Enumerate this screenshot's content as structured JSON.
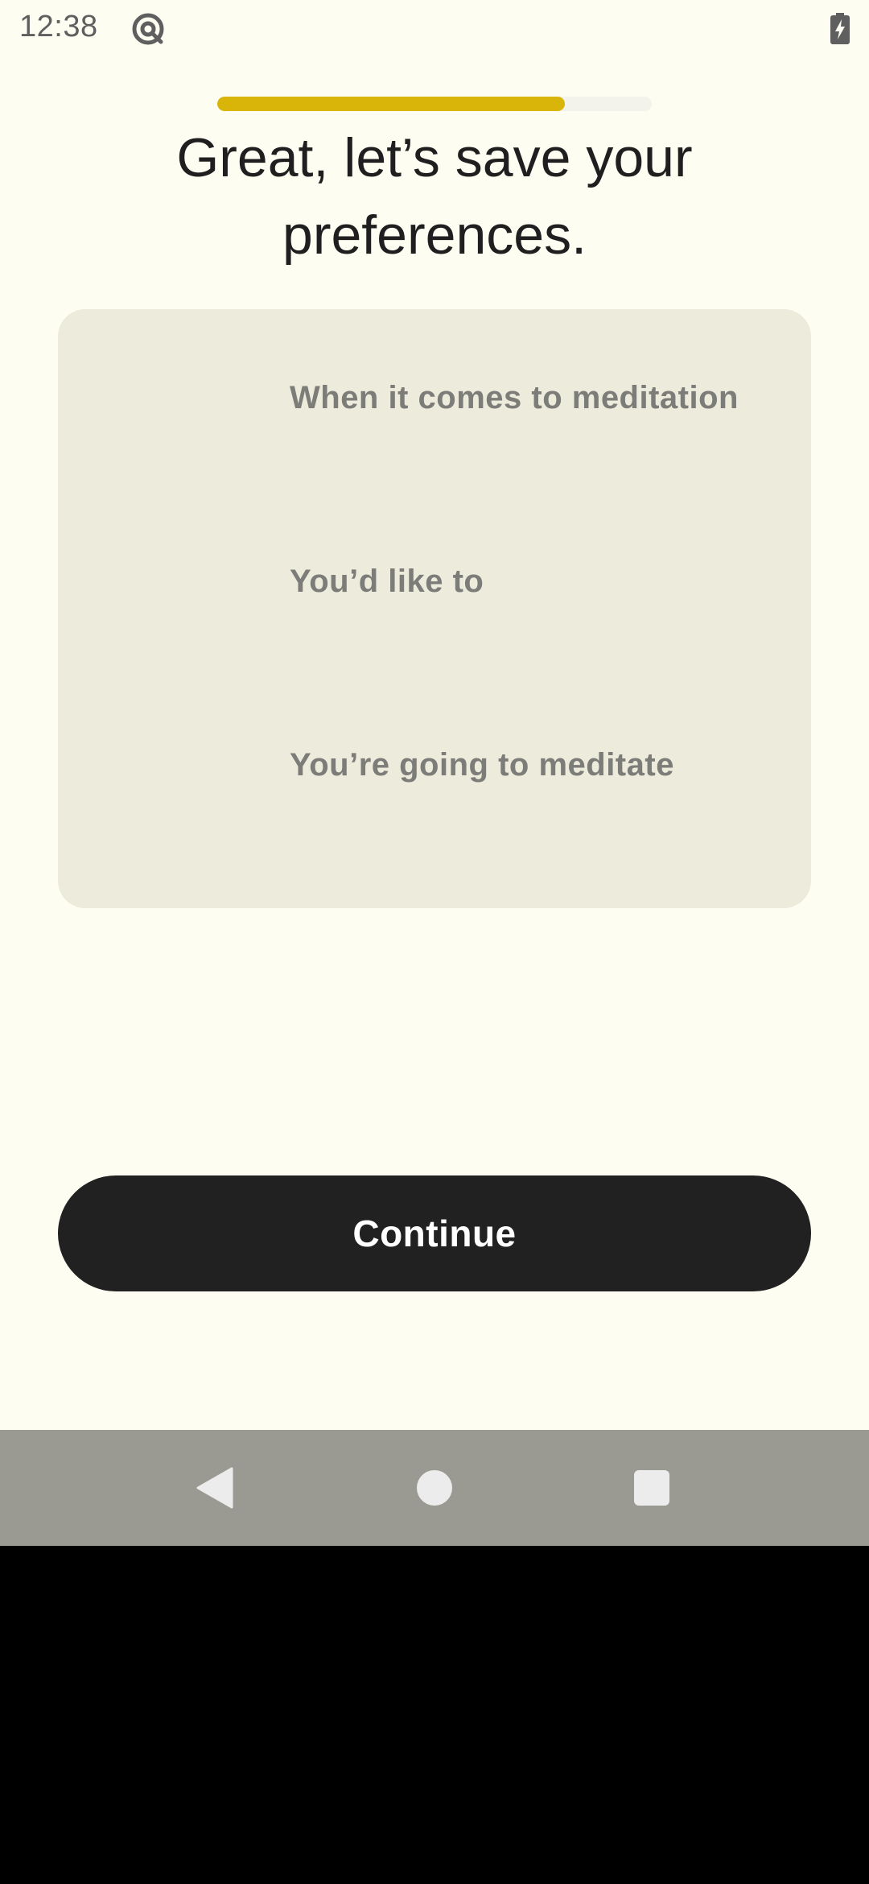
{
  "status_bar": {
    "time": "12:38",
    "notification_icon": "at-sign-circle-icon",
    "battery_icon": "battery-charging-icon"
  },
  "progress": {
    "fraction": 0.8,
    "fill_color": "#D9B50A",
    "track_color": "#F3F3EC"
  },
  "page": {
    "title": "Great, let’s save your preferences."
  },
  "preferences_card": {
    "lines": [
      "When it comes to meditation",
      "You’d like to",
      "You’re going to meditate"
    ]
  },
  "continue_button": {
    "label": "Continue"
  },
  "navigation_bar": {
    "back_icon": "back-triangle-icon",
    "home_icon": "home-circle-icon",
    "recents_icon": "recents-square-icon"
  },
  "colors": {
    "background": "#FDFDF1",
    "card": "#EDEBDB",
    "button": "#212121",
    "accent": "#D9B50A"
  }
}
